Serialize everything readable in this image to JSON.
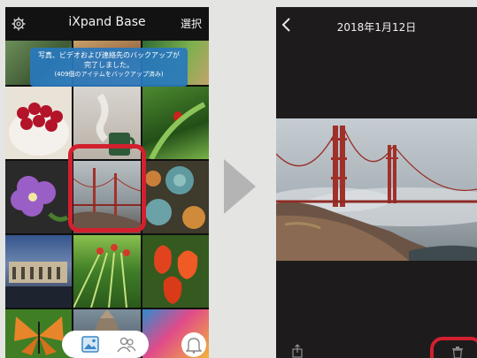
{
  "left_screen": {
    "header": {
      "settings_icon": "gear-icon",
      "title": "iXpand Base",
      "select_label": "選択"
    },
    "banner": {
      "line1": "写真、ビデオおよび連絡先のバックアップが",
      "line2": "完了しました。",
      "line3": "(409個のアイテムをバックアップ済み)"
    },
    "tabbar": {
      "photos_icon": "photos-icon",
      "contacts_icon": "contacts-icon",
      "notifications_icon": "bell-icon"
    },
    "highlight_color": "#d2202f"
  },
  "right_screen": {
    "header": {
      "back_icon": "chevron-left-icon",
      "title": "2018年1月12日"
    },
    "toolbar": {
      "share_icon": "share-icon",
      "delete_icon": "trash-icon"
    }
  },
  "transition_icon": "arrow-right-icon"
}
